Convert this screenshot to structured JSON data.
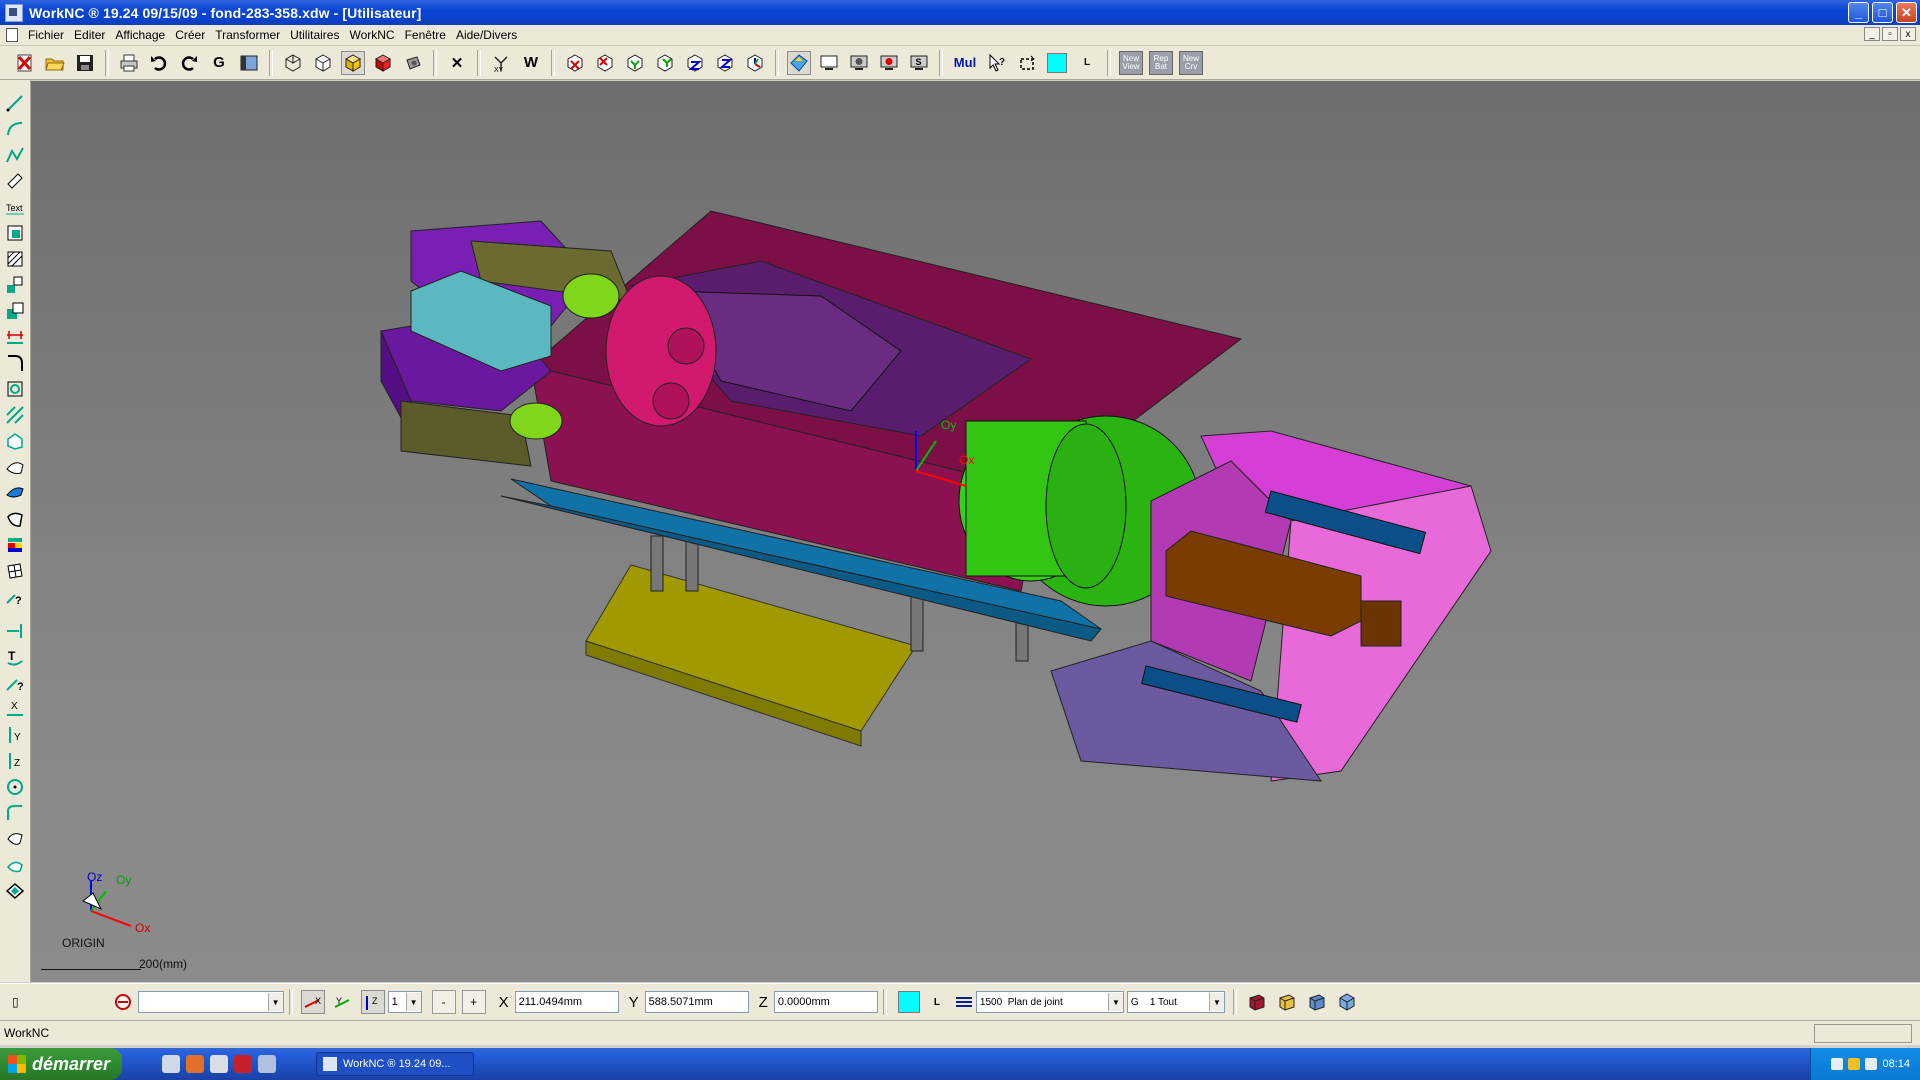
{
  "window": {
    "title": "WorkNC ® 19.24  09/15/09 - fond-283-358.xdw - [Utilisateur]",
    "controls": {
      "minimize": "_",
      "maximize": "□",
      "close": "✕"
    }
  },
  "menu": {
    "items": [
      "Fichier",
      "Editer",
      "Affichage",
      "Créer",
      "Transformer",
      "Utilitaires",
      "WorkNC",
      "Fenêtre",
      "Aide/Divers"
    ],
    "mdi": {
      "minimize": "_",
      "restore": "▫",
      "close": "x"
    }
  },
  "toolbar": {
    "g_label": "G",
    "w_label": "W",
    "mul_label": "Mul",
    "l_label": "L",
    "new_view_label": "New\nView",
    "rep_label": "Rep\nBat",
    "new_crv_label": "New\nCrv",
    "close_x": "✕",
    "swatch_color": "#00ffff"
  },
  "viewport": {
    "axis_labels": {
      "ox": "Ox",
      "oy": "Oy",
      "oz": "Oz"
    },
    "center_axis_labels": {
      "oy": "Oy",
      "ox": "Ox"
    },
    "origin_label": "ORIGIN",
    "scale_label": "200(mm)",
    "background": "#7a7a7a"
  },
  "coordbar": {
    "layer_combo": "",
    "step_value": "1",
    "minus": "-",
    "plus": "+",
    "x_label": "X",
    "x_value": "211.0494mm",
    "y_label": "Y",
    "y_value": "588.5071mm",
    "z_label": "Z",
    "z_value": "0.0000mm",
    "l_label": "L",
    "level_combo": "1500  Plan de joint",
    "group_combo": "G    1 Tout",
    "cursor_marker": "▯"
  },
  "status": {
    "text": "WorkNC"
  },
  "taskbar": {
    "start_label": "démarrer",
    "task_label": "WorkNC ® 19.24  09...",
    "clock": "08:14"
  }
}
